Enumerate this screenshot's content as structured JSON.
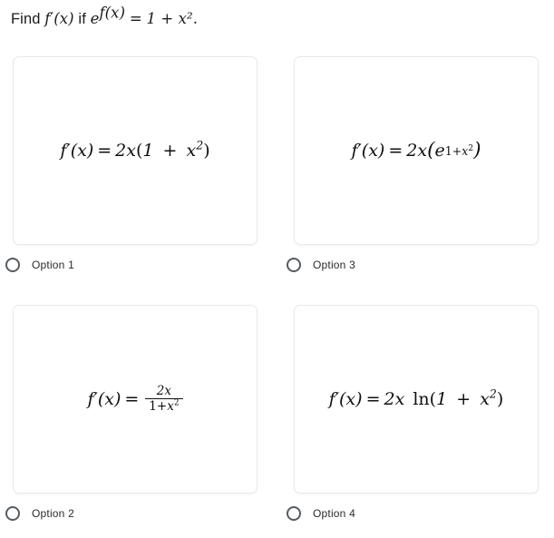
{
  "question": {
    "prefix": "Find",
    "func": "f′(x)",
    "conjunction": "if",
    "lhs_base": "e",
    "lhs_exponent": "f(x)",
    "equals": "=",
    "rhs": "1 + x²",
    "period": ".",
    "full_text": "Find f′(x) if e^{f(x)} = 1 + x²."
  },
  "options": [
    {
      "id": "option-1",
      "label": "Option 1",
      "position": "top-left",
      "selected": false,
      "formula_text": "f′(x) = 2x(1 + x²)",
      "lhs": "f′(x)",
      "equals": "=",
      "coefficient": "2x",
      "open_paren": "(",
      "inner": "1 + x²",
      "close_paren": ")",
      "type": "plain"
    },
    {
      "id": "option-3",
      "label": "Option 3",
      "position": "top-right",
      "selected": false,
      "formula_text": "f′(x) = 2x(e^{1+x²})",
      "lhs": "f′(x)",
      "equals": "=",
      "coefficient": "2x",
      "open_paren": "(",
      "inner_base": "e",
      "inner_exponent": "1+x²",
      "close_paren": ")",
      "type": "exponential"
    },
    {
      "id": "option-2",
      "label": "Option 2",
      "position": "bottom-left",
      "selected": false,
      "formula_text": "f′(x) = 2x/(1+x²)",
      "lhs": "f′(x)",
      "equals": "=",
      "numerator": "2x",
      "denominator": "1+x²",
      "type": "fraction"
    },
    {
      "id": "option-4",
      "label": "Option 4",
      "position": "bottom-right",
      "selected": false,
      "formula_text": "f′(x) = 2x ln(1 + x²)",
      "lhs": "f′(x)",
      "equals": "=",
      "coefficient": "2x",
      "function_name": "ln",
      "open_paren": "(",
      "inner": "1 + x²",
      "close_paren": ")",
      "type": "logarithm"
    }
  ],
  "colors": {
    "background": "#ffffff",
    "card_background": "#ffffff",
    "card_border": "#e9e9e9",
    "text": "#222222",
    "radio_border": "#555b60"
  }
}
